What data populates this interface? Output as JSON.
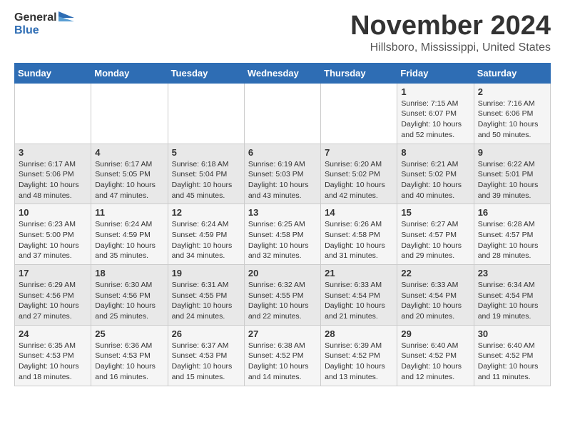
{
  "logo": {
    "general": "General",
    "blue": "Blue"
  },
  "title": "November 2024",
  "location": "Hillsboro, Mississippi, United States",
  "weekdays": [
    "Sunday",
    "Monday",
    "Tuesday",
    "Wednesday",
    "Thursday",
    "Friday",
    "Saturday"
  ],
  "weeks": [
    [
      {
        "day": "",
        "info": ""
      },
      {
        "day": "",
        "info": ""
      },
      {
        "day": "",
        "info": ""
      },
      {
        "day": "",
        "info": ""
      },
      {
        "day": "",
        "info": ""
      },
      {
        "day": "1",
        "info": "Sunrise: 7:15 AM\nSunset: 6:07 PM\nDaylight: 10 hours\nand 52 minutes."
      },
      {
        "day": "2",
        "info": "Sunrise: 7:16 AM\nSunset: 6:06 PM\nDaylight: 10 hours\nand 50 minutes."
      }
    ],
    [
      {
        "day": "3",
        "info": "Sunrise: 6:17 AM\nSunset: 5:06 PM\nDaylight: 10 hours\nand 48 minutes."
      },
      {
        "day": "4",
        "info": "Sunrise: 6:17 AM\nSunset: 5:05 PM\nDaylight: 10 hours\nand 47 minutes."
      },
      {
        "day": "5",
        "info": "Sunrise: 6:18 AM\nSunset: 5:04 PM\nDaylight: 10 hours\nand 45 minutes."
      },
      {
        "day": "6",
        "info": "Sunrise: 6:19 AM\nSunset: 5:03 PM\nDaylight: 10 hours\nand 43 minutes."
      },
      {
        "day": "7",
        "info": "Sunrise: 6:20 AM\nSunset: 5:02 PM\nDaylight: 10 hours\nand 42 minutes."
      },
      {
        "day": "8",
        "info": "Sunrise: 6:21 AM\nSunset: 5:02 PM\nDaylight: 10 hours\nand 40 minutes."
      },
      {
        "day": "9",
        "info": "Sunrise: 6:22 AM\nSunset: 5:01 PM\nDaylight: 10 hours\nand 39 minutes."
      }
    ],
    [
      {
        "day": "10",
        "info": "Sunrise: 6:23 AM\nSunset: 5:00 PM\nDaylight: 10 hours\nand 37 minutes."
      },
      {
        "day": "11",
        "info": "Sunrise: 6:24 AM\nSunset: 4:59 PM\nDaylight: 10 hours\nand 35 minutes."
      },
      {
        "day": "12",
        "info": "Sunrise: 6:24 AM\nSunset: 4:59 PM\nDaylight: 10 hours\nand 34 minutes."
      },
      {
        "day": "13",
        "info": "Sunrise: 6:25 AM\nSunset: 4:58 PM\nDaylight: 10 hours\nand 32 minutes."
      },
      {
        "day": "14",
        "info": "Sunrise: 6:26 AM\nSunset: 4:58 PM\nDaylight: 10 hours\nand 31 minutes."
      },
      {
        "day": "15",
        "info": "Sunrise: 6:27 AM\nSunset: 4:57 PM\nDaylight: 10 hours\nand 29 minutes."
      },
      {
        "day": "16",
        "info": "Sunrise: 6:28 AM\nSunset: 4:57 PM\nDaylight: 10 hours\nand 28 minutes."
      }
    ],
    [
      {
        "day": "17",
        "info": "Sunrise: 6:29 AM\nSunset: 4:56 PM\nDaylight: 10 hours\nand 27 minutes."
      },
      {
        "day": "18",
        "info": "Sunrise: 6:30 AM\nSunset: 4:56 PM\nDaylight: 10 hours\nand 25 minutes."
      },
      {
        "day": "19",
        "info": "Sunrise: 6:31 AM\nSunset: 4:55 PM\nDaylight: 10 hours\nand 24 minutes."
      },
      {
        "day": "20",
        "info": "Sunrise: 6:32 AM\nSunset: 4:55 PM\nDaylight: 10 hours\nand 22 minutes."
      },
      {
        "day": "21",
        "info": "Sunrise: 6:33 AM\nSunset: 4:54 PM\nDaylight: 10 hours\nand 21 minutes."
      },
      {
        "day": "22",
        "info": "Sunrise: 6:33 AM\nSunset: 4:54 PM\nDaylight: 10 hours\nand 20 minutes."
      },
      {
        "day": "23",
        "info": "Sunrise: 6:34 AM\nSunset: 4:54 PM\nDaylight: 10 hours\nand 19 minutes."
      }
    ],
    [
      {
        "day": "24",
        "info": "Sunrise: 6:35 AM\nSunset: 4:53 PM\nDaylight: 10 hours\nand 18 minutes."
      },
      {
        "day": "25",
        "info": "Sunrise: 6:36 AM\nSunset: 4:53 PM\nDaylight: 10 hours\nand 16 minutes."
      },
      {
        "day": "26",
        "info": "Sunrise: 6:37 AM\nSunset: 4:53 PM\nDaylight: 10 hours\nand 15 minutes."
      },
      {
        "day": "27",
        "info": "Sunrise: 6:38 AM\nSunset: 4:52 PM\nDaylight: 10 hours\nand 14 minutes."
      },
      {
        "day": "28",
        "info": "Sunrise: 6:39 AM\nSunset: 4:52 PM\nDaylight: 10 hours\nand 13 minutes."
      },
      {
        "day": "29",
        "info": "Sunrise: 6:40 AM\nSunset: 4:52 PM\nDaylight: 10 hours\nand 12 minutes."
      },
      {
        "day": "30",
        "info": "Sunrise: 6:40 AM\nSunset: 4:52 PM\nDaylight: 10 hours\nand 11 minutes."
      }
    ]
  ]
}
